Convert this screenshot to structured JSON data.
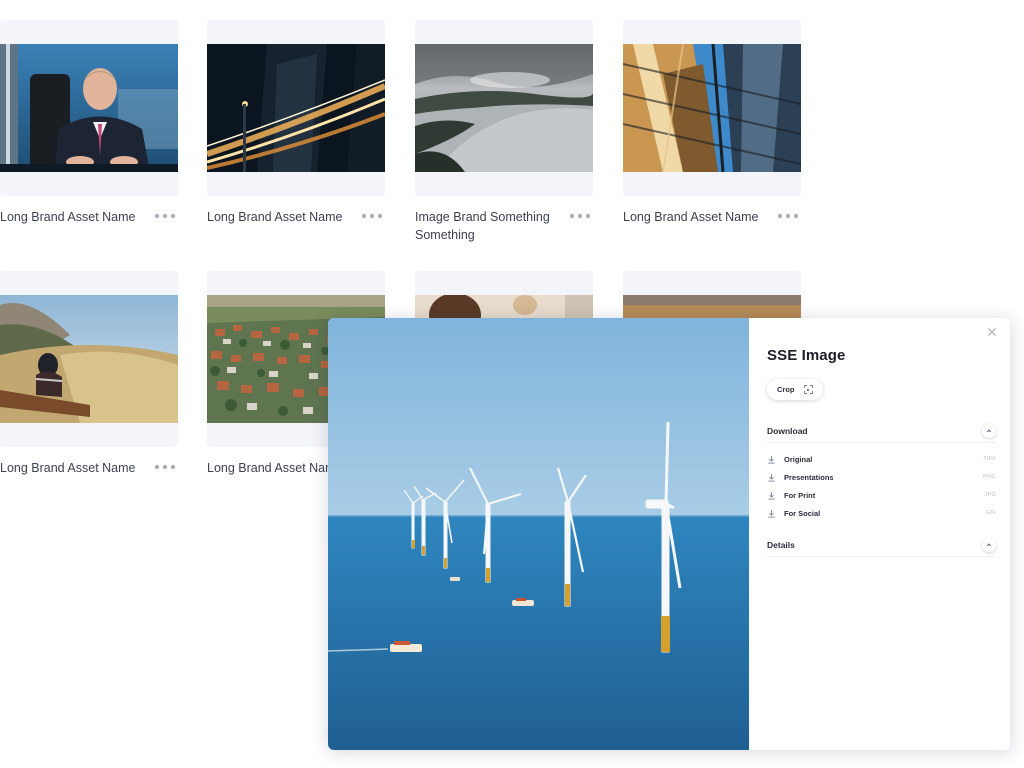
{
  "assets": [
    {
      "name": "Long Brand Asset Name",
      "image": "businessman-portrait"
    },
    {
      "name": "Long Brand Asset Name",
      "image": "city-light-trails"
    },
    {
      "name": "Image Brand Something Something",
      "image": "lake-mountains-aerial"
    },
    {
      "name": "Long Brand Asset Name",
      "image": "glass-building-upward"
    },
    {
      "name": "Long Brand Asset Name",
      "image": "woman-hillside-grass"
    },
    {
      "name": "Long Brand Asset Name",
      "image": "village-aerial"
    },
    {
      "name": "",
      "image": "person-portrait"
    },
    {
      "name": "",
      "image": "sunset-landscape"
    }
  ],
  "more_icon": "more-horizontal-icon",
  "preview": {
    "image": "offshore-wind-turbines",
    "close_icon": "close-icon",
    "title": "SSE Image",
    "crop_label": "Crop",
    "crop_icon": "crop-icon",
    "download": {
      "title": "Download",
      "items": [
        {
          "label": "Original",
          "format": "TIFF",
          "icon": "download-icon"
        },
        {
          "label": "Presentations",
          "format": "PNG",
          "icon": "download-icon"
        },
        {
          "label": "For Print",
          "format": "JPG",
          "icon": "download-icon"
        },
        {
          "label": "For Social",
          "format": "GIF",
          "icon": "download-icon"
        }
      ]
    },
    "details": {
      "title": "Details"
    }
  },
  "colors": {
    "card_bg": "#f4f5fa",
    "text": "#3d4150",
    "muted": "#a7abb8",
    "sea": "#2f7fb6",
    "sky": "#8fbde0"
  }
}
